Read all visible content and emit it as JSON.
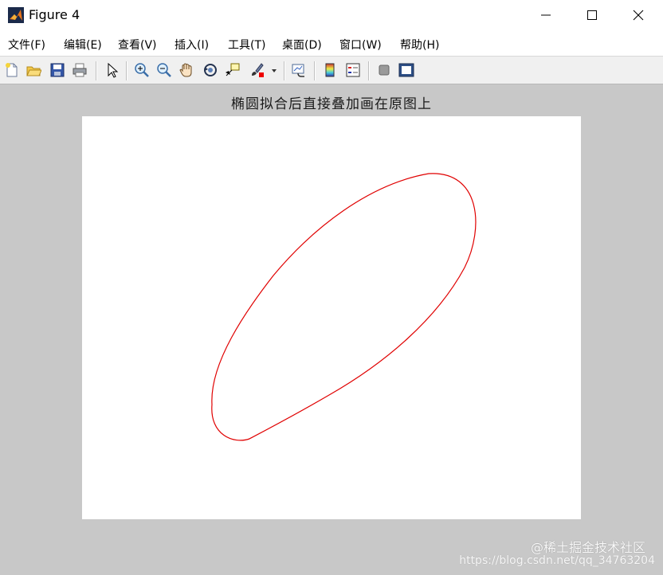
{
  "window": {
    "title": "Figure 4",
    "icon": "matlab-logo-icon",
    "controls": [
      "minimize-icon",
      "maximize-icon",
      "close-icon"
    ]
  },
  "menu": {
    "items": [
      {
        "label": "文件(F)"
      },
      {
        "label": "编辑(E)"
      },
      {
        "label": "查看(V)"
      },
      {
        "label": "插入(I)"
      },
      {
        "label": "工具(T)"
      },
      {
        "label": "桌面(D)"
      },
      {
        "label": "窗口(W)"
      },
      {
        "label": "帮助(H)"
      }
    ],
    "dock_glyph": "↘"
  },
  "toolbar": {
    "icons": [
      "new-figure-icon",
      "open-file-icon",
      "save-icon",
      "print-icon",
      "edit-plot-arrow-icon",
      "zoom-in-icon",
      "zoom-out-icon",
      "pan-hand-icon",
      "rotate-3d-icon",
      "data-cursor-icon",
      "brush-icon",
      "link-plot-icon",
      "colorbar-icon",
      "legend-icon",
      "hide-plot-tools-icon",
      "show-plot-tools-icon"
    ]
  },
  "plot": {
    "title": "椭圆拟合后直接叠加画在原图上",
    "curve_color": "#e00000"
  },
  "watermark": {
    "line1": "@稀土掘金技术社区",
    "line2": "https://blog.csdn.net/qq_34763204"
  }
}
